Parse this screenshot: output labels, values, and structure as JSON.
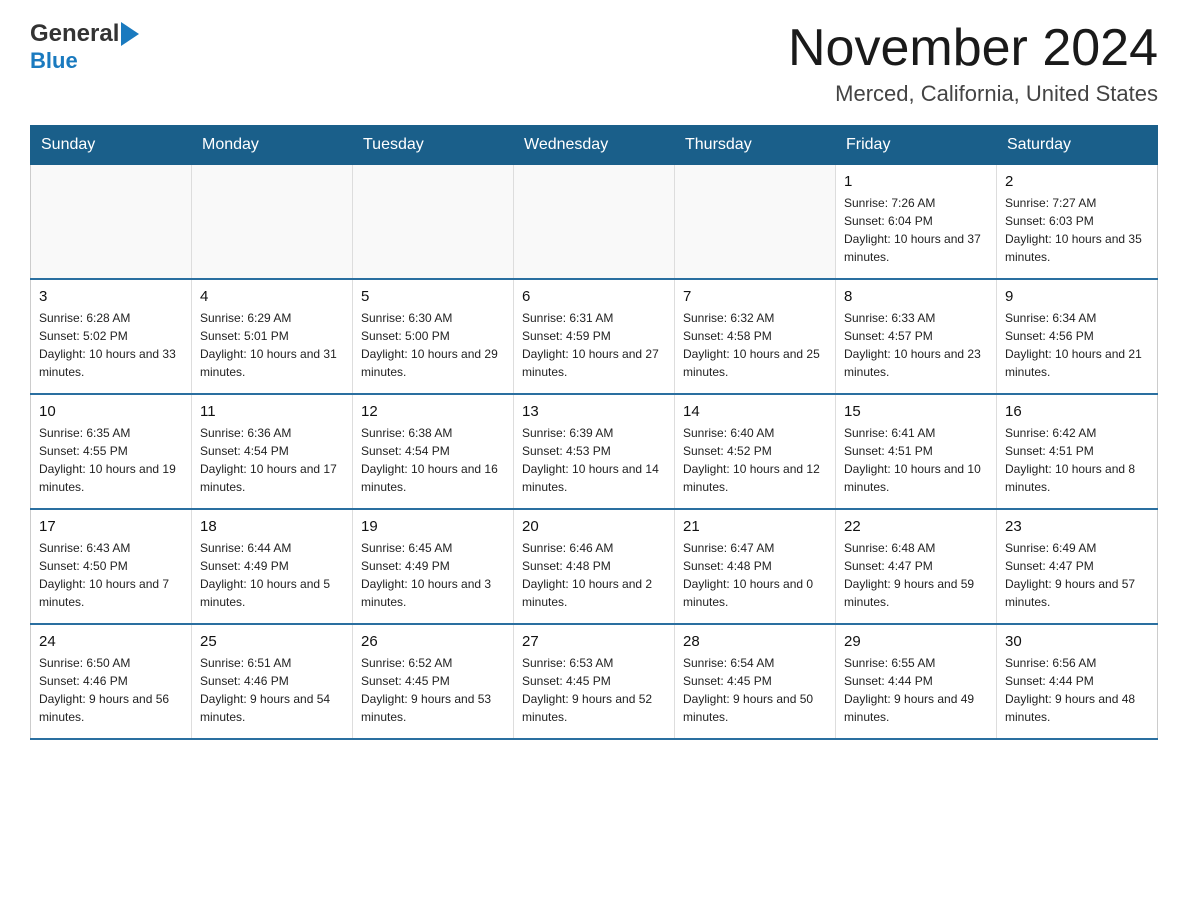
{
  "header": {
    "logo_general": "General",
    "logo_blue": "Blue",
    "title": "November 2024",
    "subtitle": "Merced, California, United States"
  },
  "weekdays": [
    "Sunday",
    "Monday",
    "Tuesday",
    "Wednesday",
    "Thursday",
    "Friday",
    "Saturday"
  ],
  "weeks": [
    [
      {
        "day": "",
        "info": ""
      },
      {
        "day": "",
        "info": ""
      },
      {
        "day": "",
        "info": ""
      },
      {
        "day": "",
        "info": ""
      },
      {
        "day": "",
        "info": ""
      },
      {
        "day": "1",
        "info": "Sunrise: 7:26 AM\nSunset: 6:04 PM\nDaylight: 10 hours and 37 minutes."
      },
      {
        "day": "2",
        "info": "Sunrise: 7:27 AM\nSunset: 6:03 PM\nDaylight: 10 hours and 35 minutes."
      }
    ],
    [
      {
        "day": "3",
        "info": "Sunrise: 6:28 AM\nSunset: 5:02 PM\nDaylight: 10 hours and 33 minutes."
      },
      {
        "day": "4",
        "info": "Sunrise: 6:29 AM\nSunset: 5:01 PM\nDaylight: 10 hours and 31 minutes."
      },
      {
        "day": "5",
        "info": "Sunrise: 6:30 AM\nSunset: 5:00 PM\nDaylight: 10 hours and 29 minutes."
      },
      {
        "day": "6",
        "info": "Sunrise: 6:31 AM\nSunset: 4:59 PM\nDaylight: 10 hours and 27 minutes."
      },
      {
        "day": "7",
        "info": "Sunrise: 6:32 AM\nSunset: 4:58 PM\nDaylight: 10 hours and 25 minutes."
      },
      {
        "day": "8",
        "info": "Sunrise: 6:33 AM\nSunset: 4:57 PM\nDaylight: 10 hours and 23 minutes."
      },
      {
        "day": "9",
        "info": "Sunrise: 6:34 AM\nSunset: 4:56 PM\nDaylight: 10 hours and 21 minutes."
      }
    ],
    [
      {
        "day": "10",
        "info": "Sunrise: 6:35 AM\nSunset: 4:55 PM\nDaylight: 10 hours and 19 minutes."
      },
      {
        "day": "11",
        "info": "Sunrise: 6:36 AM\nSunset: 4:54 PM\nDaylight: 10 hours and 17 minutes."
      },
      {
        "day": "12",
        "info": "Sunrise: 6:38 AM\nSunset: 4:54 PM\nDaylight: 10 hours and 16 minutes."
      },
      {
        "day": "13",
        "info": "Sunrise: 6:39 AM\nSunset: 4:53 PM\nDaylight: 10 hours and 14 minutes."
      },
      {
        "day": "14",
        "info": "Sunrise: 6:40 AM\nSunset: 4:52 PM\nDaylight: 10 hours and 12 minutes."
      },
      {
        "day": "15",
        "info": "Sunrise: 6:41 AM\nSunset: 4:51 PM\nDaylight: 10 hours and 10 minutes."
      },
      {
        "day": "16",
        "info": "Sunrise: 6:42 AM\nSunset: 4:51 PM\nDaylight: 10 hours and 8 minutes."
      }
    ],
    [
      {
        "day": "17",
        "info": "Sunrise: 6:43 AM\nSunset: 4:50 PM\nDaylight: 10 hours and 7 minutes."
      },
      {
        "day": "18",
        "info": "Sunrise: 6:44 AM\nSunset: 4:49 PM\nDaylight: 10 hours and 5 minutes."
      },
      {
        "day": "19",
        "info": "Sunrise: 6:45 AM\nSunset: 4:49 PM\nDaylight: 10 hours and 3 minutes."
      },
      {
        "day": "20",
        "info": "Sunrise: 6:46 AM\nSunset: 4:48 PM\nDaylight: 10 hours and 2 minutes."
      },
      {
        "day": "21",
        "info": "Sunrise: 6:47 AM\nSunset: 4:48 PM\nDaylight: 10 hours and 0 minutes."
      },
      {
        "day": "22",
        "info": "Sunrise: 6:48 AM\nSunset: 4:47 PM\nDaylight: 9 hours and 59 minutes."
      },
      {
        "day": "23",
        "info": "Sunrise: 6:49 AM\nSunset: 4:47 PM\nDaylight: 9 hours and 57 minutes."
      }
    ],
    [
      {
        "day": "24",
        "info": "Sunrise: 6:50 AM\nSunset: 4:46 PM\nDaylight: 9 hours and 56 minutes."
      },
      {
        "day": "25",
        "info": "Sunrise: 6:51 AM\nSunset: 4:46 PM\nDaylight: 9 hours and 54 minutes."
      },
      {
        "day": "26",
        "info": "Sunrise: 6:52 AM\nSunset: 4:45 PM\nDaylight: 9 hours and 53 minutes."
      },
      {
        "day": "27",
        "info": "Sunrise: 6:53 AM\nSunset: 4:45 PM\nDaylight: 9 hours and 52 minutes."
      },
      {
        "day": "28",
        "info": "Sunrise: 6:54 AM\nSunset: 4:45 PM\nDaylight: 9 hours and 50 minutes."
      },
      {
        "day": "29",
        "info": "Sunrise: 6:55 AM\nSunset: 4:44 PM\nDaylight: 9 hours and 49 minutes."
      },
      {
        "day": "30",
        "info": "Sunrise: 6:56 AM\nSunset: 4:44 PM\nDaylight: 9 hours and 48 minutes."
      }
    ]
  ]
}
